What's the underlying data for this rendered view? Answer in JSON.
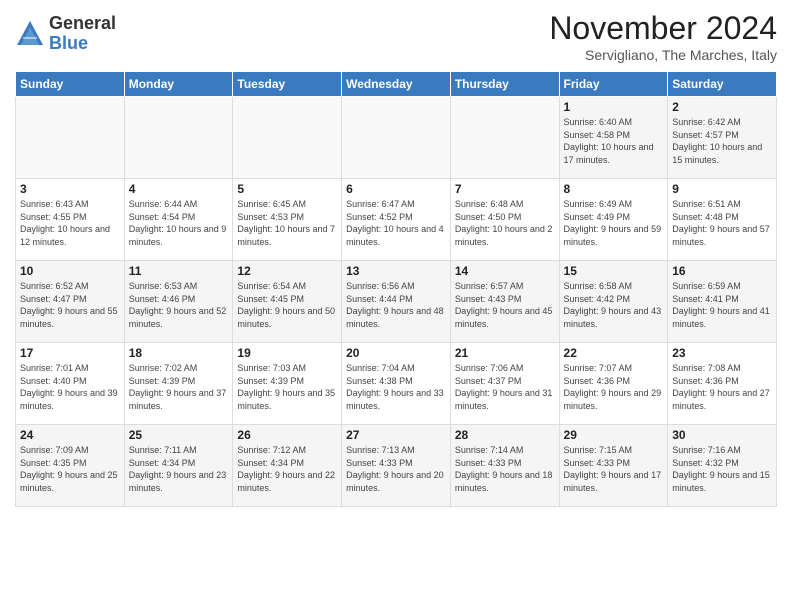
{
  "logo": {
    "general": "General",
    "blue": "Blue"
  },
  "title": "November 2024",
  "subtitle": "Servigliano, The Marches, Italy",
  "headers": [
    "Sunday",
    "Monday",
    "Tuesday",
    "Wednesday",
    "Thursday",
    "Friday",
    "Saturday"
  ],
  "rows": [
    [
      {
        "day": "",
        "info": ""
      },
      {
        "day": "",
        "info": ""
      },
      {
        "day": "",
        "info": ""
      },
      {
        "day": "",
        "info": ""
      },
      {
        "day": "",
        "info": ""
      },
      {
        "day": "1",
        "info": "Sunrise: 6:40 AM\nSunset: 4:58 PM\nDaylight: 10 hours and 17 minutes."
      },
      {
        "day": "2",
        "info": "Sunrise: 6:42 AM\nSunset: 4:57 PM\nDaylight: 10 hours and 15 minutes."
      }
    ],
    [
      {
        "day": "3",
        "info": "Sunrise: 6:43 AM\nSunset: 4:55 PM\nDaylight: 10 hours and 12 minutes."
      },
      {
        "day": "4",
        "info": "Sunrise: 6:44 AM\nSunset: 4:54 PM\nDaylight: 10 hours and 9 minutes."
      },
      {
        "day": "5",
        "info": "Sunrise: 6:45 AM\nSunset: 4:53 PM\nDaylight: 10 hours and 7 minutes."
      },
      {
        "day": "6",
        "info": "Sunrise: 6:47 AM\nSunset: 4:52 PM\nDaylight: 10 hours and 4 minutes."
      },
      {
        "day": "7",
        "info": "Sunrise: 6:48 AM\nSunset: 4:50 PM\nDaylight: 10 hours and 2 minutes."
      },
      {
        "day": "8",
        "info": "Sunrise: 6:49 AM\nSunset: 4:49 PM\nDaylight: 9 hours and 59 minutes."
      },
      {
        "day": "9",
        "info": "Sunrise: 6:51 AM\nSunset: 4:48 PM\nDaylight: 9 hours and 57 minutes."
      }
    ],
    [
      {
        "day": "10",
        "info": "Sunrise: 6:52 AM\nSunset: 4:47 PM\nDaylight: 9 hours and 55 minutes."
      },
      {
        "day": "11",
        "info": "Sunrise: 6:53 AM\nSunset: 4:46 PM\nDaylight: 9 hours and 52 minutes."
      },
      {
        "day": "12",
        "info": "Sunrise: 6:54 AM\nSunset: 4:45 PM\nDaylight: 9 hours and 50 minutes."
      },
      {
        "day": "13",
        "info": "Sunrise: 6:56 AM\nSunset: 4:44 PM\nDaylight: 9 hours and 48 minutes."
      },
      {
        "day": "14",
        "info": "Sunrise: 6:57 AM\nSunset: 4:43 PM\nDaylight: 9 hours and 45 minutes."
      },
      {
        "day": "15",
        "info": "Sunrise: 6:58 AM\nSunset: 4:42 PM\nDaylight: 9 hours and 43 minutes."
      },
      {
        "day": "16",
        "info": "Sunrise: 6:59 AM\nSunset: 4:41 PM\nDaylight: 9 hours and 41 minutes."
      }
    ],
    [
      {
        "day": "17",
        "info": "Sunrise: 7:01 AM\nSunset: 4:40 PM\nDaylight: 9 hours and 39 minutes."
      },
      {
        "day": "18",
        "info": "Sunrise: 7:02 AM\nSunset: 4:39 PM\nDaylight: 9 hours and 37 minutes."
      },
      {
        "day": "19",
        "info": "Sunrise: 7:03 AM\nSunset: 4:39 PM\nDaylight: 9 hours and 35 minutes."
      },
      {
        "day": "20",
        "info": "Sunrise: 7:04 AM\nSunset: 4:38 PM\nDaylight: 9 hours and 33 minutes."
      },
      {
        "day": "21",
        "info": "Sunrise: 7:06 AM\nSunset: 4:37 PM\nDaylight: 9 hours and 31 minutes."
      },
      {
        "day": "22",
        "info": "Sunrise: 7:07 AM\nSunset: 4:36 PM\nDaylight: 9 hours and 29 minutes."
      },
      {
        "day": "23",
        "info": "Sunrise: 7:08 AM\nSunset: 4:36 PM\nDaylight: 9 hours and 27 minutes."
      }
    ],
    [
      {
        "day": "24",
        "info": "Sunrise: 7:09 AM\nSunset: 4:35 PM\nDaylight: 9 hours and 25 minutes."
      },
      {
        "day": "25",
        "info": "Sunrise: 7:11 AM\nSunset: 4:34 PM\nDaylight: 9 hours and 23 minutes."
      },
      {
        "day": "26",
        "info": "Sunrise: 7:12 AM\nSunset: 4:34 PM\nDaylight: 9 hours and 22 minutes."
      },
      {
        "day": "27",
        "info": "Sunrise: 7:13 AM\nSunset: 4:33 PM\nDaylight: 9 hours and 20 minutes."
      },
      {
        "day": "28",
        "info": "Sunrise: 7:14 AM\nSunset: 4:33 PM\nDaylight: 9 hours and 18 minutes."
      },
      {
        "day": "29",
        "info": "Sunrise: 7:15 AM\nSunset: 4:33 PM\nDaylight: 9 hours and 17 minutes."
      },
      {
        "day": "30",
        "info": "Sunrise: 7:16 AM\nSunset: 4:32 PM\nDaylight: 9 hours and 15 minutes."
      }
    ]
  ]
}
